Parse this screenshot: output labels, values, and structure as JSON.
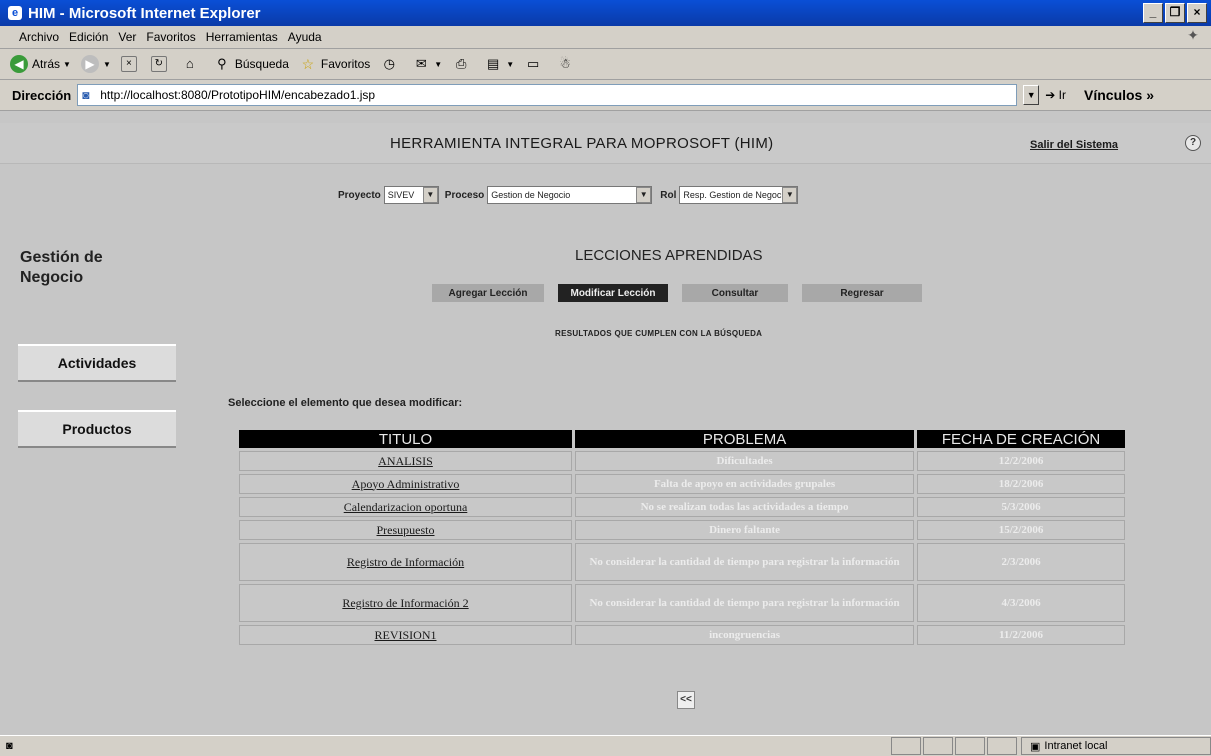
{
  "window": {
    "title": "HIM - Microsoft Internet Explorer",
    "buttons": [
      "_",
      "❐",
      "×"
    ]
  },
  "menubar": {
    "items": [
      "Archivo",
      "Edición",
      "Ver",
      "Favoritos",
      "Herramientas",
      "Ayuda"
    ]
  },
  "toolbar": {
    "back": "Atrás",
    "search": "Búsqueda",
    "favorites": "Favoritos"
  },
  "address": {
    "label": "Dirección",
    "url": "http://localhost:8080/PrototipoHIM/encabezado1.jsp",
    "go": "Ir",
    "links": "Vínculos"
  },
  "app": {
    "title": "HERRAMIENTA INTEGRAL PARA MOPROSOFT (HIM)",
    "logout": "Salir del Sistema",
    "help": "?"
  },
  "filters": {
    "project_label": "Proyecto",
    "project_value": "SIVEV",
    "process_label": "Proceso",
    "process_value": "Gestion de Negocio",
    "role_label": "Rol",
    "role_value": "Resp. Gestion de Negocio"
  },
  "nav": {
    "title_line1": "Gestión de",
    "title_line2": "Negocio",
    "activities": "Actividades",
    "products": "Productos"
  },
  "main": {
    "title": "LECCIONES APRENDIDAS",
    "actions": {
      "add": "Agregar Lección",
      "modify": "Modificar Lección",
      "consult": "Consultar",
      "back": "Regresar"
    },
    "results": "RESULTADOS QUE CUMPLEN CON LA BÚSQUEDA",
    "select_msg": "Seleccione el elemento que desea modificar:",
    "back_button": "<<"
  },
  "table": {
    "headers": [
      "TITULO",
      "PROBLEMA",
      "FECHA DE CREACIÓN"
    ],
    "rows": [
      {
        "titulo": "ANALISIS",
        "problema": "Dificultades",
        "fecha": "12/2/2006"
      },
      {
        "titulo": "Apoyo Administrativo",
        "problema": "Falta de apoyo en actividades grupales",
        "fecha": "18/2/2006"
      },
      {
        "titulo": "Calendarizacion oportuna",
        "problema": "No se realizan todas las actividades a tiempo",
        "fecha": "5/3/2006"
      },
      {
        "titulo": "Presupuesto",
        "problema": "Dinero faltante",
        "fecha": "15/2/2006"
      },
      {
        "titulo": "Registro de Información",
        "problema": "No considerar la cantidad de tiempo para registrar la información",
        "fecha": "2/3/2006"
      },
      {
        "titulo": "Registro de Información 2",
        "problema": "No considerar la cantidad de tiempo para registrar la información",
        "fecha": "4/3/2006"
      },
      {
        "titulo": "REVISION1",
        "problema": "incongruencias",
        "fecha": "11/2/2006"
      }
    ]
  },
  "status": {
    "zone": "Intranet local"
  }
}
